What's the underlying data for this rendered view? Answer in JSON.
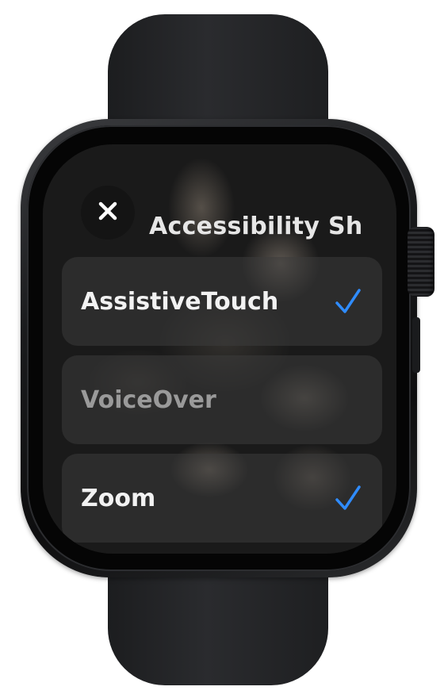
{
  "screen": {
    "close_icon": "xmark",
    "title": "Accessibility Sh",
    "items": [
      {
        "label": "AssistiveTouch",
        "checked": true,
        "enabled": true
      },
      {
        "label": "VoiceOver",
        "checked": false,
        "enabled": false
      },
      {
        "label": "Zoom",
        "checked": true,
        "enabled": true
      }
    ]
  },
  "colors": {
    "checkmark": "#2f8cff",
    "row_background": "#3c3c3c",
    "text_primary": "#f2f2f2",
    "text_dimmed": "#9a9a9a"
  }
}
